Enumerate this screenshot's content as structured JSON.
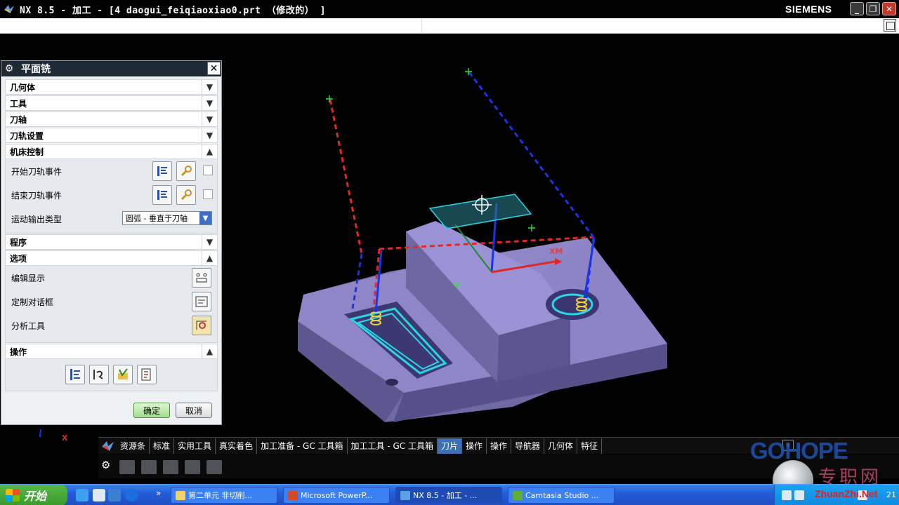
{
  "window": {
    "title": "NX 8.5 - 加工 - [4 daogui_feiqiaoxiao0.prt （修改的） ]",
    "brand": "SIEMENS",
    "minimize_label": "_",
    "maximize_label": "❐",
    "close_label": "✕"
  },
  "dialog": {
    "title": "平面铣",
    "gear_icon": "⚙",
    "close_label": "✕",
    "sections": {
      "geometry": "几何体",
      "tool": "工具",
      "tool_axis": "刀轴",
      "path_settings": "刀轨设置",
      "machine_control": "机床控制",
      "program": "程序",
      "options": "选项",
      "actions": "操作"
    },
    "machine_control": {
      "start_event": "开始刀轨事件",
      "end_event": "结束刀轨事件",
      "motion_output_label": "运动输出类型",
      "motion_output_value": "圆弧 - 垂直于刀轴"
    },
    "options": {
      "edit_display": "编辑显示",
      "custom_dialog": "定制对话框",
      "analysis_tools": "分析工具"
    },
    "ok_label": "确定",
    "cancel_label": "取消"
  },
  "viewport": {
    "xm_label": "XM",
    "x_label": "X"
  },
  "resource_tabs": [
    {
      "label": "资源条"
    },
    {
      "label": "标准"
    },
    {
      "label": "实用工具"
    },
    {
      "label": "真实着色"
    },
    {
      "label": "加工准备 - GC 工具箱"
    },
    {
      "label": "加工工具 - GC 工具箱"
    },
    {
      "label": "刀片",
      "active": true
    },
    {
      "label": "操作"
    },
    {
      "label": "操作"
    },
    {
      "label": "导航器"
    },
    {
      "label": "几何体"
    },
    {
      "label": "特征"
    }
  ],
  "watermark": {
    "brand": "GOHOPE",
    "cn": "专职网",
    "site": "ZhuanZhi.Net"
  },
  "taskbar": {
    "start_label": "开始",
    "tasks": [
      {
        "label": "第二单元  非切削..."
      },
      {
        "label": "Microsoft PowerP..."
      },
      {
        "label": "NX 8.5 - 加工 - ...",
        "active": true
      },
      {
        "label": "Camtasia Studio ..."
      }
    ],
    "more_label": "»",
    "clock": "21"
  },
  "colors": {
    "part_face": "#8f86c8",
    "part_side": "#6f6aa4",
    "toolpath": "#2ad6e6",
    "axis_red": "#e02828",
    "axis_blue": "#1c34e8",
    "active_tab": "#3b6fb6"
  }
}
